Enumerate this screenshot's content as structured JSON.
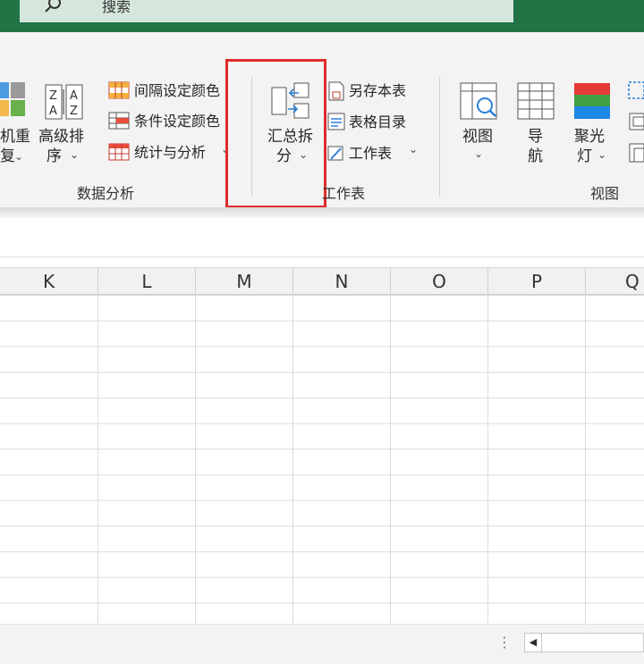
{
  "titlebar": {
    "search_label": "搜索",
    "bg_color": "#217346"
  },
  "ribbon": {
    "sort_partial_line1": "机重",
    "sort_partial_line2": "复",
    "advanced_sort_line1": "高级排",
    "advanced_sort_line2": "序",
    "interval_color": "间隔设定颜色",
    "condition_color": "条件设定颜色",
    "stats_analysis": "统计与分析",
    "group_data_analysis": "数据分析",
    "summary_split_line1": "汇总拆",
    "summary_split_line2": "分",
    "save_as_sheet": "另存本表",
    "table_directory": "表格目录",
    "worksheet": "工作表",
    "group_worksheet": "工作表",
    "view_line1": "视图",
    "nav_line1": "导",
    "nav_line2": "航",
    "spotlight_line1": "聚光",
    "spotlight_line2": "灯",
    "group_view": "视图",
    "highlight_color": "#e02b2b"
  },
  "grid": {
    "columns": [
      "K",
      "L",
      "M",
      "N",
      "O",
      "P",
      "Q"
    ]
  },
  "statusbar": {
    "more_glyph": "⋮",
    "scroll_left_glyph": "◀"
  }
}
